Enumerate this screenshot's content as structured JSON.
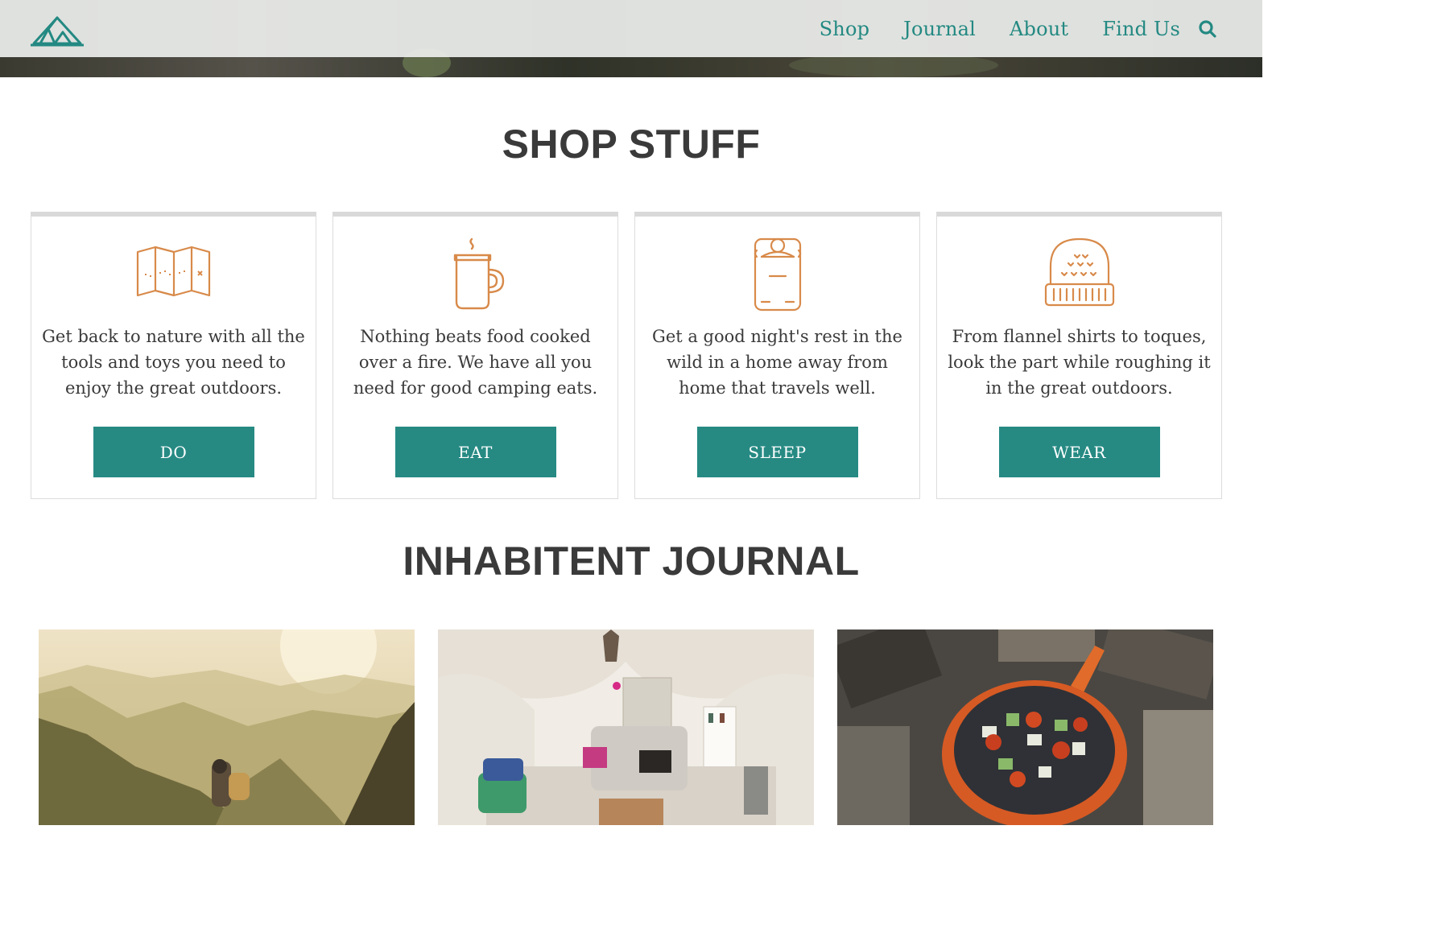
{
  "nav": {
    "logo_icon": "tent-logo-icon",
    "items": [
      "Shop",
      "Journal",
      "About",
      "Find Us"
    ],
    "search_icon": "search-icon"
  },
  "shop": {
    "title": "SHOP STUFF",
    "cards": [
      {
        "icon": "map-icon",
        "description": "Get back to nature with all the tools and toys you need to enjoy the great outdoors.",
        "button": "DO"
      },
      {
        "icon": "mug-icon",
        "description": "Nothing beats food cooked over a fire. We have all you need for good camping eats.",
        "button": "EAT"
      },
      {
        "icon": "sleeping-bag-icon",
        "description": "Get a good night's rest in the wild in a home away from home that travels well.",
        "button": "SLEEP"
      },
      {
        "icon": "toque-icon",
        "description": "From flannel shirts to toques, look the part while roughing it in the great outdoors.",
        "button": "WEAR"
      }
    ]
  },
  "journal": {
    "title": "INHABITENT JOURNAL",
    "photos": [
      "mountain-hiker-photo",
      "glamping-tent-interior-photo",
      "campfire-skillet-photo"
    ]
  },
  "colors": {
    "accent": "#268a83",
    "icon": "#d88a4a",
    "heading": "#3a3a3a"
  }
}
